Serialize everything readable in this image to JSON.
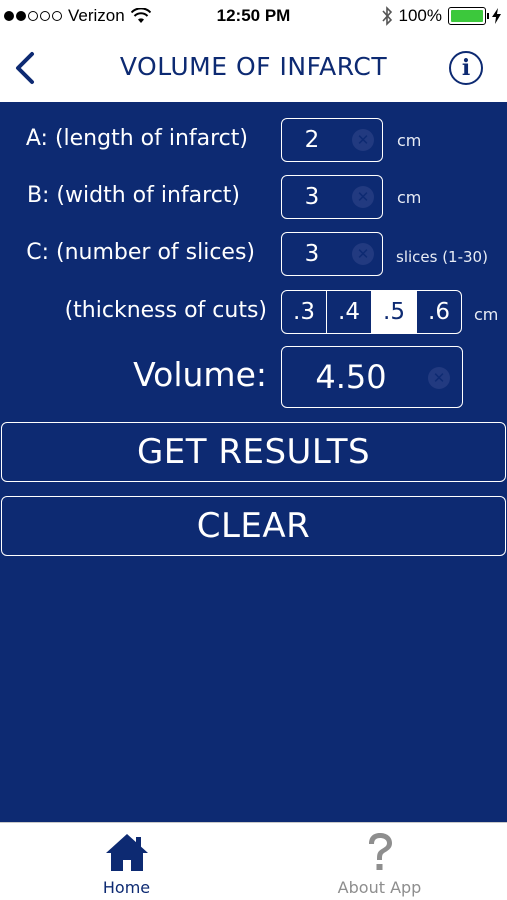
{
  "status_bar": {
    "carrier": "Verizon",
    "time": "12:50 PM",
    "battery": "100%"
  },
  "nav": {
    "title": "VOLUME OF INFARCT",
    "info_glyph": "i"
  },
  "form": {
    "rows": [
      {
        "label": "A: (length of infarct)",
        "value": "2",
        "unit": "cm"
      },
      {
        "label": "B: (width of infarct)",
        "value": "3",
        "unit": "cm"
      },
      {
        "label": "C: (number of slices)",
        "value": "3",
        "unit": "slices (1-30)"
      }
    ],
    "thickness": {
      "label": "(thickness of cuts)",
      "options": [
        ".3",
        ".4",
        ".5",
        ".6"
      ],
      "selected": ".5",
      "unit": "cm"
    },
    "volume": {
      "label": "Volume:",
      "value": "4.50"
    }
  },
  "buttons": {
    "get_results": "GET RESULTS",
    "clear": "CLEAR"
  },
  "tabs": [
    {
      "label": "Home",
      "icon": "home-icon",
      "active": true
    },
    {
      "label": "About App",
      "icon": "question-icon",
      "active": false
    }
  ],
  "colors": {
    "primary": "#0d2a72",
    "battery": "#3cc83c",
    "inactive": "#8e8e8e"
  }
}
